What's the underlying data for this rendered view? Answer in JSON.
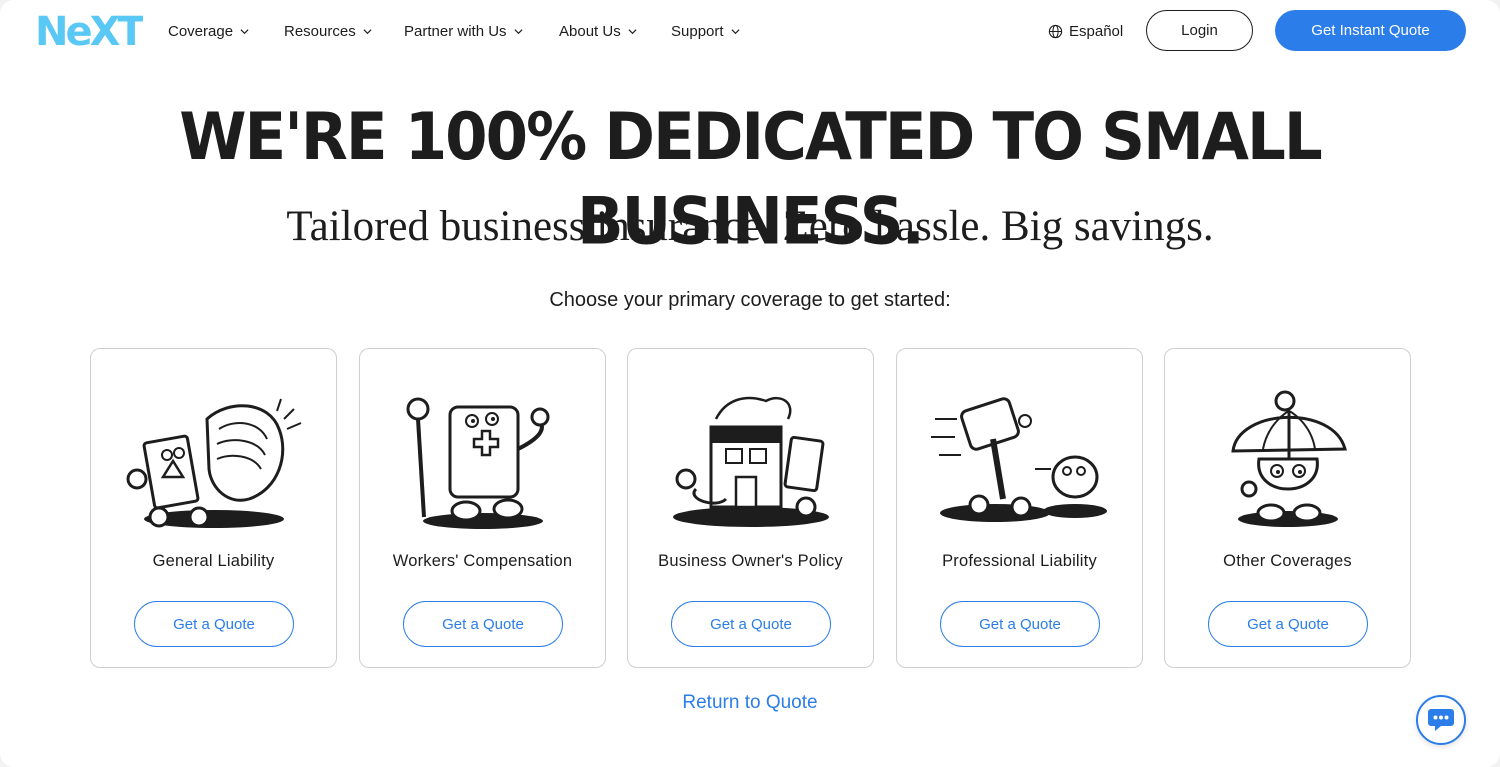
{
  "brand": {
    "logo_text": "NeXT",
    "accent_color": "#2b7de9",
    "logo_color": "#5ac8f5"
  },
  "nav": {
    "items": [
      {
        "label": "Coverage"
      },
      {
        "label": "Resources"
      },
      {
        "label": "Partner with Us"
      },
      {
        "label": "About Us"
      },
      {
        "label": "Support"
      }
    ],
    "language_label": "Español",
    "login_label": "Login",
    "cta_label": "Get Instant Quote"
  },
  "hero": {
    "headline": "WE'RE 100% DEDICATED TO SMALL BUSINESS.",
    "subheadline": "Tailored business insurance. Zero hassle. Big savings.",
    "prompt": "Choose your primary coverage to get started:"
  },
  "coverages": [
    {
      "label": "General Liability",
      "button": "Get a Quote",
      "icon": "general-liability-illustration"
    },
    {
      "label": "Workers' Compensation",
      "button": "Get a Quote",
      "icon": "workers-compensation-illustration"
    },
    {
      "label": "Business Owner's Policy",
      "button": "Get a Quote",
      "icon": "business-owners-policy-illustration"
    },
    {
      "label": "Professional Liability",
      "button": "Get a Quote",
      "icon": "professional-liability-illustration"
    },
    {
      "label": "Other Coverages",
      "button": "Get a Quote",
      "icon": "other-coverages-illustration"
    }
  ],
  "return_label": "Return to Quote",
  "chat": {
    "icon": "chat-bubble-icon"
  }
}
